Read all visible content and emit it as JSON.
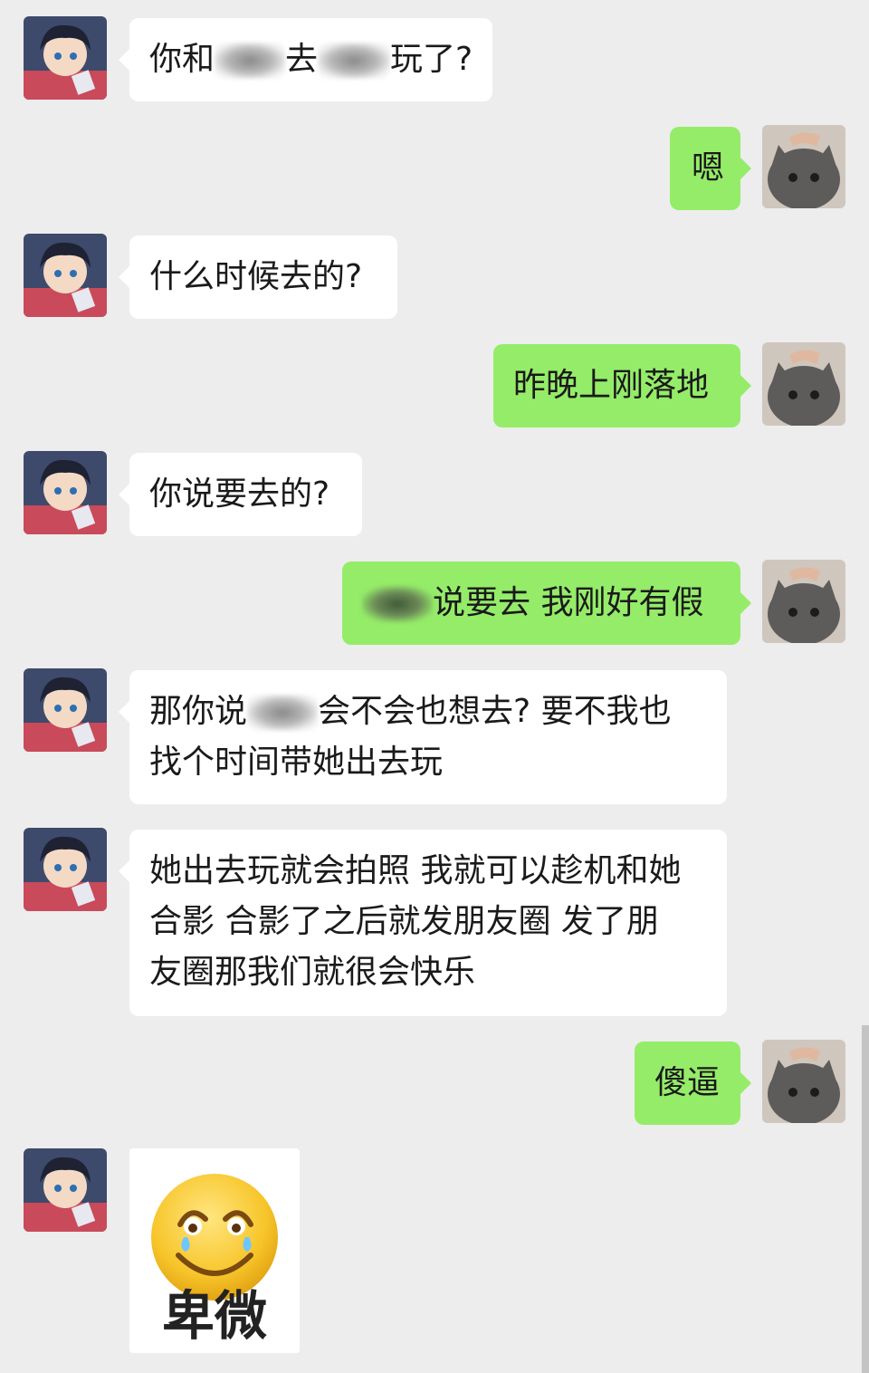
{
  "messages": [
    {
      "side": "in",
      "segments": [
        "你和",
        "去",
        "玩了?"
      ]
    },
    {
      "side": "out",
      "text": "嗯"
    },
    {
      "side": "in",
      "text": "什么时候去的?"
    },
    {
      "side": "out",
      "text": "昨晚上刚落地"
    },
    {
      "side": "in",
      "text": "你说要去的?"
    },
    {
      "side": "out",
      "text": "说要去 我刚好有假"
    },
    {
      "side": "in",
      "lines": [
        "那你说",
        "会不会也想去? 要不我也",
        "找个时间带她出去玩"
      ]
    },
    {
      "side": "in",
      "lines": [
        "她出去玩就会拍照 我就可以趁机和她",
        "合影 合影了之后就发朋友圈 发了朋",
        "友圈那我们就很会快乐"
      ]
    },
    {
      "side": "out",
      "text": "傻逼"
    },
    {
      "side": "in",
      "sticker": "crying-smile-emoji",
      "caption": "卑微"
    }
  ],
  "colors": {
    "background": "#ededed",
    "incoming_bubble": "#ffffff",
    "outgoing_bubble": "#95ec69"
  },
  "avatars": {
    "left": "anime-boy-avatar",
    "right": "gray-cat-avatar"
  }
}
